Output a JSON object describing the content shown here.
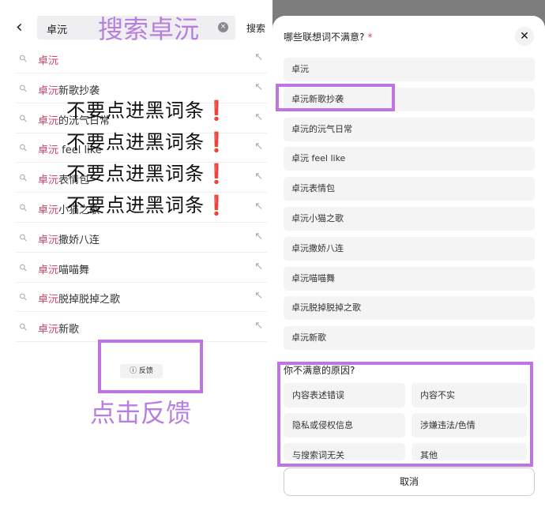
{
  "search": {
    "back_icon": "chevron-left",
    "query": "卓沅",
    "clear_icon": "×",
    "button": "搜索"
  },
  "suggestions": [
    {
      "hl": "卓沅",
      "rest": ""
    },
    {
      "hl": "卓沅",
      "rest": "新歌抄袭"
    },
    {
      "hl": "卓沅",
      "rest": "的沅气日常"
    },
    {
      "hl": "卓沅",
      "rest": " feel like"
    },
    {
      "hl": "卓沅",
      "rest": "表情包"
    },
    {
      "hl": "卓沅",
      "rest": "小猫之歌"
    },
    {
      "hl": "卓沅",
      "rest": "撒娇八连"
    },
    {
      "hl": "卓沅",
      "rest": "喵喵舞"
    },
    {
      "hl": "卓沅",
      "rest": "脱掉脱掉之歌"
    },
    {
      "hl": "卓沅",
      "rest": "新歌"
    }
  ],
  "feedback_button": "ⓘ 反馈",
  "annotations": {
    "search_title": "搜索卓沅",
    "warning": "不要点进黑词条",
    "warning_mark": "❗",
    "click_hint": "点击反馈"
  },
  "sheet": {
    "title": "哪些联想词不满意?",
    "required_mark": "*",
    "close": "✕",
    "items": [
      "卓沅",
      "卓沅新歌抄袭",
      "卓沅的沅气日常",
      "卓沅 feel like",
      "卓沅表情包",
      "卓沅小猫之歌",
      "卓沅撒娇八连",
      "卓沅喵喵舞",
      "卓沅脱掉脱掉之歌",
      "卓沅新歌"
    ],
    "reasons_title": "你不满意的原因?",
    "reasons": [
      "内容表述错误",
      "内容不实",
      "隐私或侵权信息",
      "涉嫌违法/色情",
      "与搜索词无关",
      "其他"
    ],
    "cancel": "取消"
  },
  "colors": {
    "accent": "#d0466c",
    "annotation": "#b77fe0"
  }
}
